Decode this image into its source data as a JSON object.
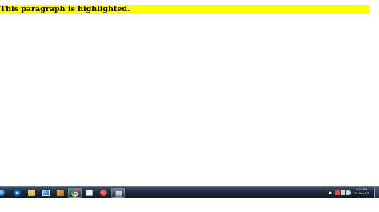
{
  "content": {
    "highlighted_paragraph": "This paragraph is highlighted.",
    "highlight_color": "#ffff00"
  },
  "taskbar": {
    "apps": [
      {
        "name": "start-orb",
        "icon": "windows-orb-icon",
        "color": "#3d8fd6",
        "active": false
      },
      {
        "name": "internet-explorer",
        "icon": "internet-explorer-icon",
        "color": "#2f7bd1",
        "active": false
      },
      {
        "name": "windows-explorer",
        "icon": "folder-icon",
        "color": "#e8c25a",
        "active": false
      },
      {
        "name": "media-player",
        "icon": "media-player-icon",
        "color": "#4a90e2",
        "active": false
      },
      {
        "name": "paint",
        "icon": "paint-icon",
        "color": "#e07a3a",
        "active": false
      },
      {
        "name": "chrome",
        "icon": "chrome-icon",
        "color": "#e34234",
        "active": true
      },
      {
        "name": "notepad",
        "icon": "notepad-icon",
        "color": "#dfe7ee",
        "active": false
      },
      {
        "name": "red-app",
        "icon": "red-app-icon",
        "color": "#d62a2a",
        "active": false
      },
      {
        "name": "misc-app",
        "icon": "window-icon",
        "color": "#9fb4c6",
        "active": true
      }
    ],
    "tray_icons": [
      {
        "name": "show-hidden-icons",
        "icon": "chevron-up-icon",
        "color": "#ffffff"
      },
      {
        "name": "action-center",
        "icon": "flag-icon",
        "color": "#e24a4a"
      },
      {
        "name": "network",
        "icon": "network-icon",
        "color": "#cfd8e0"
      },
      {
        "name": "volume",
        "icon": "speaker-icon",
        "color": "#cfd8e0"
      }
    ],
    "clock_time": "3:08 PM",
    "clock_date": "16-Dec-15"
  }
}
